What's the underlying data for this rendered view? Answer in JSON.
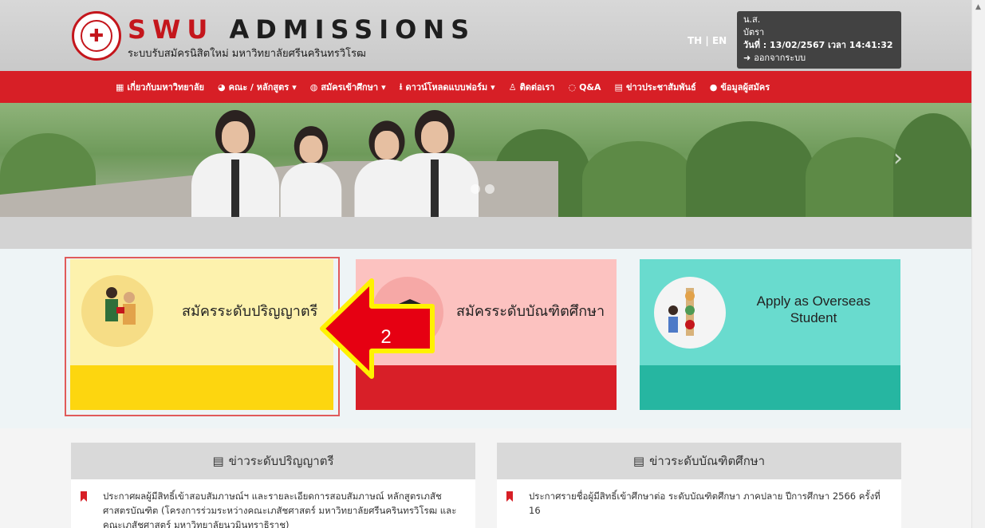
{
  "header": {
    "brand_red": "SWU",
    "brand_dark": "ADMISSIONS",
    "subtitle": "ระบบรับสมัครนิสิตใหม่ มหาวิทยาลัยศรีนครินทรวิโรฒ",
    "lang": "TH | EN",
    "user": {
      "title": "น.ส.",
      "name": "บัตรา",
      "date": "วันที่ : 13/02/2567 เวลา 14:41:32",
      "logout": "ออกจากระบบ"
    }
  },
  "nav": {
    "items": [
      {
        "label": "เกี่ยวกับมหาวิทยาลัย",
        "icon": "building-icon"
      },
      {
        "label": "คณะ / หลักสูตร",
        "icon": "book-icon",
        "dropdown": true
      },
      {
        "label": "สมัครเข้าศึกษา",
        "icon": "globe-icon",
        "dropdown": true
      },
      {
        "label": "ดาวน์โหลดแบบฟอร์ม",
        "icon": "download-icon",
        "dropdown": true
      },
      {
        "label": "ติดต่อเรา",
        "icon": "people-icon"
      },
      {
        "label": "Q&A",
        "icon": "chat-icon"
      },
      {
        "label": "ข่าวประชาสัมพันธ์",
        "icon": "newspaper-icon"
      },
      {
        "label": "ข้อมูลผู้สมัคร",
        "icon": "user-icon"
      }
    ]
  },
  "cards": [
    {
      "label": "สมัครระดับปริญญาตรี",
      "top_color": "#fdf2ad",
      "bottom_color": "#fdd60f"
    },
    {
      "label": "สมัครระดับบัณฑิตศึกษา",
      "top_color": "#fcc2c0",
      "bottom_color": "#d81f28"
    },
    {
      "label": "Apply as Overseas Student",
      "top_color": "#69dbce",
      "bottom_color": "#26b6a1"
    }
  ],
  "callout": {
    "number": "2",
    "fill": "#e60012",
    "stroke": "#fff200"
  },
  "news": {
    "left": {
      "title": "ข่าวระดับปริญญาตรี",
      "item": "ประกาศผลผู้มีสิทธิ์เข้าสอบสัมภาษณ์ฯ และรายละเอียดการสอบสัมภาษณ์ หลักสูตรเภสัชศาสตรบัณฑิต (โครงการร่วมระหว่างคณะเภสัชศาสตร์ มหาวิทยาลัยศรีนครินทรวิโรฒ และคณะเภสัชศาสตร์ มหาวิทยาลัยนวมินทราธิราช)"
    },
    "right": {
      "title": "ข่าวระดับบัณฑิตศึกษา",
      "item": "ประกาศรายชื่อผู้มีสิทธิ์เข้าศึกษาต่อ ระดับบัณฑิตศึกษา ภาคปลาย ปีการศึกษา 2566 ครั้งที่ 16"
    }
  },
  "colors": {
    "brand_red": "#c4161c",
    "nav_bg": "#d71f26"
  }
}
